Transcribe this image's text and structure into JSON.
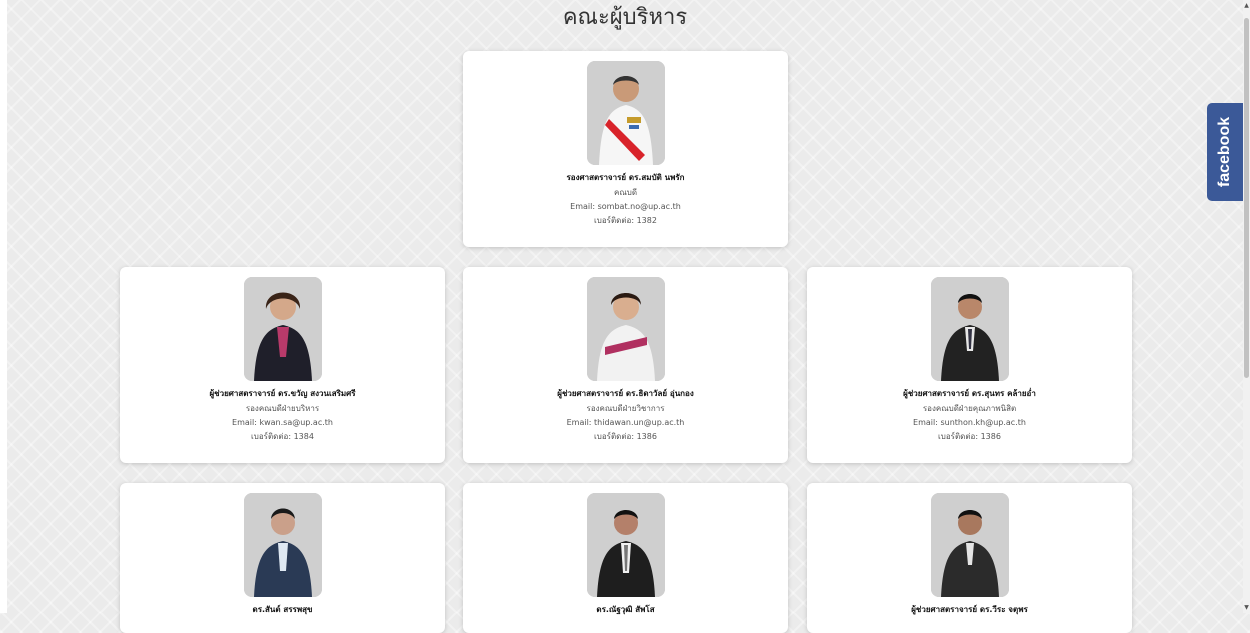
{
  "page": {
    "title": "คณะผู้บริหาร"
  },
  "colors": {
    "facebook": "#3b5998",
    "background": "#ebebeb",
    "card": "#ffffff"
  },
  "facebook_tab": {
    "label": "facebook",
    "icon": "facebook-icon"
  },
  "executives": [
    {
      "name": "รองศาสตราจารย์ ดร.สมบัติ นพรัก",
      "position": "คณบดี",
      "email": "Email: sombat.no@up.ac.th",
      "phone": "เบอร์ติดต่อ: 1382"
    },
    {
      "name": "ผู้ช่วยศาสตราจารย์ ดร.ขวัญ สงวนเสริมศรี",
      "position": "รองคณบดีฝ่ายบริหาร",
      "email": "Email: kwan.sa@up.ac.th",
      "phone": "เบอร์ติดต่อ: 1384"
    },
    {
      "name": "ผู้ช่วยศาสตราจารย์ ดร.ธิดาวัลย์ อุ่นกอง",
      "position": "รองคณบดีฝ่ายวิชาการ",
      "email": "Email: thidawan.un@up.ac.th",
      "phone": "เบอร์ติดต่อ: 1386"
    },
    {
      "name": "ผู้ช่วยศาสตราจารย์ ดร.สุนทร คล้ายอ่ำ",
      "position": "รองคณบดีฝ่ายคุณภาพนิสิต",
      "email": "Email: sunthon.kh@up.ac.th",
      "phone": "เบอร์ติดต่อ: 1386"
    },
    {
      "name": "ดร.สันต์ สรรพสุข"
    },
    {
      "name": "ดร.ณัฐวุฒิ สัพโส"
    },
    {
      "name": "ผู้ช่วยศาสตราจารย์ ดร.วีระ จตุพร"
    }
  ],
  "scrollbar": {
    "up": "▲",
    "down": "▼"
  }
}
